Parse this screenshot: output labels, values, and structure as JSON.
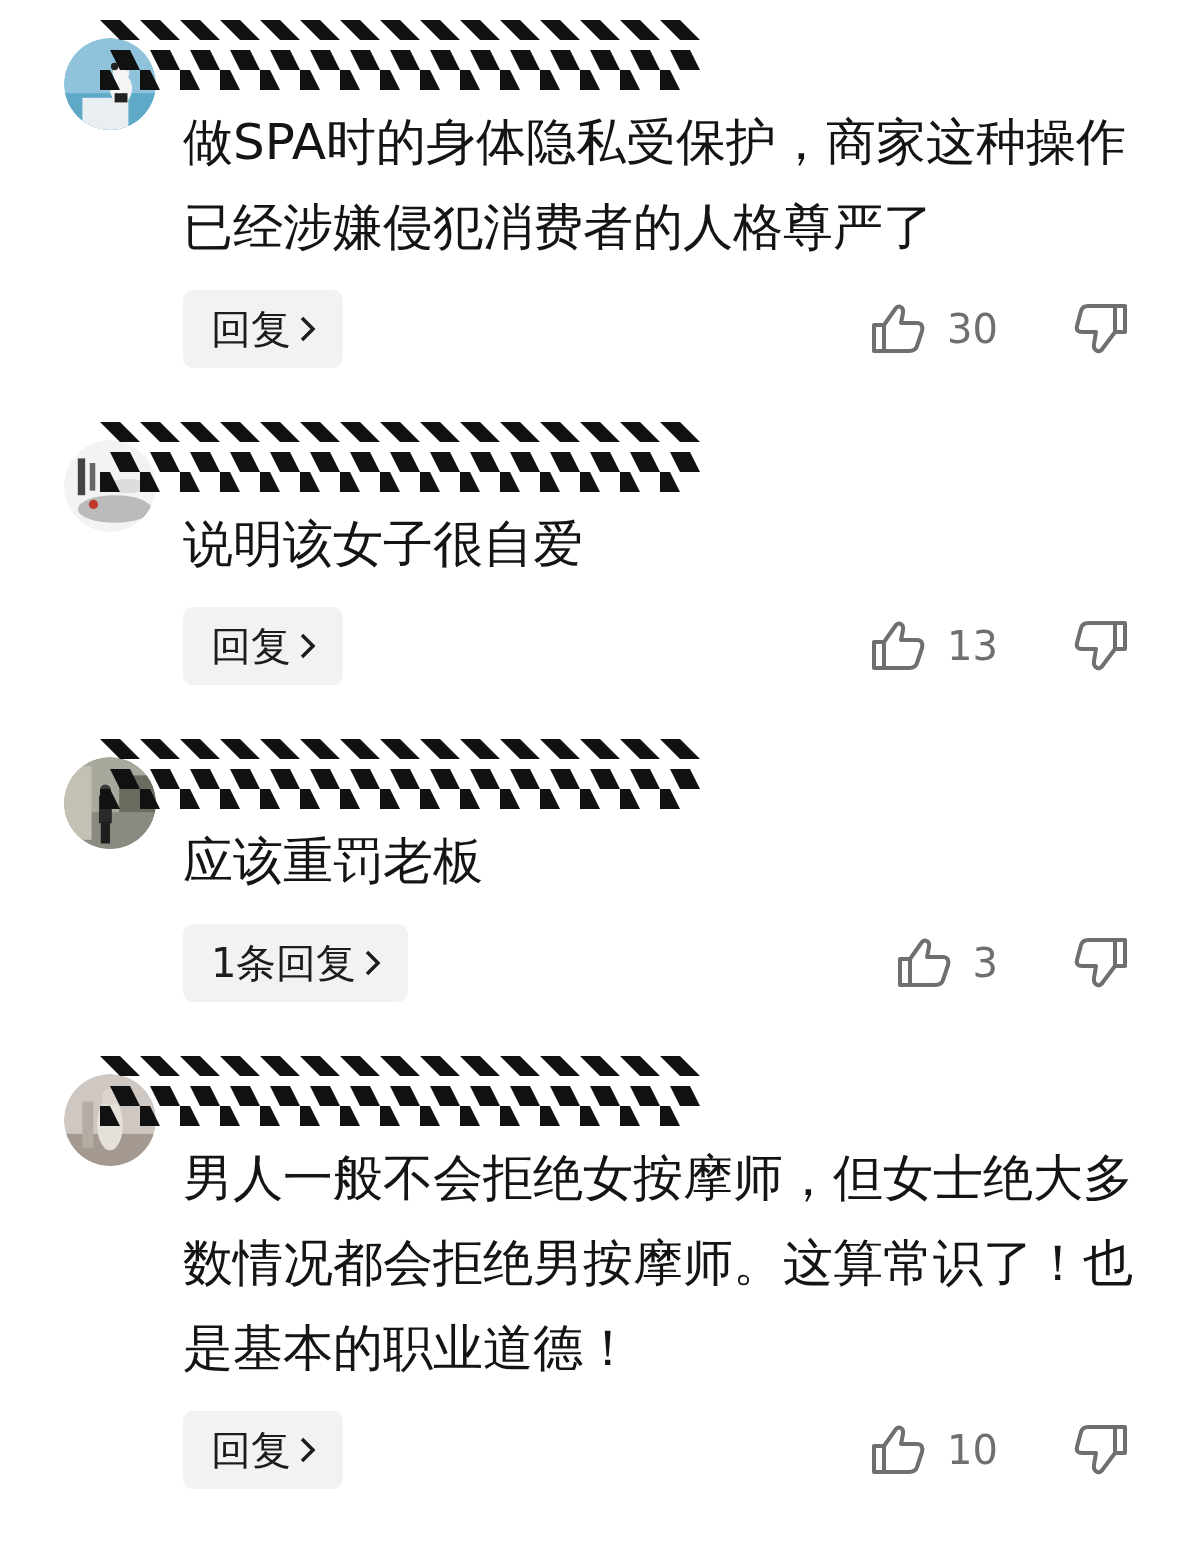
{
  "comments": [
    {
      "text": "做SPA时的身体隐私受保护，商家这种操作已经涉嫌侵犯消费者的人格尊严了",
      "reply_label": "回复",
      "likes": "30"
    },
    {
      "text": "说明该女子很自爱",
      "reply_label": "回复",
      "likes": "13"
    },
    {
      "text": "应该重罚老板",
      "reply_label": "1条回复",
      "likes": "3"
    },
    {
      "text": "男人一般不会拒绝女按摩师，但女士绝大多数情况都会拒绝男按摩师。这算常识了！也是基本的职业道德！",
      "reply_label": "回复",
      "likes": "10"
    }
  ]
}
